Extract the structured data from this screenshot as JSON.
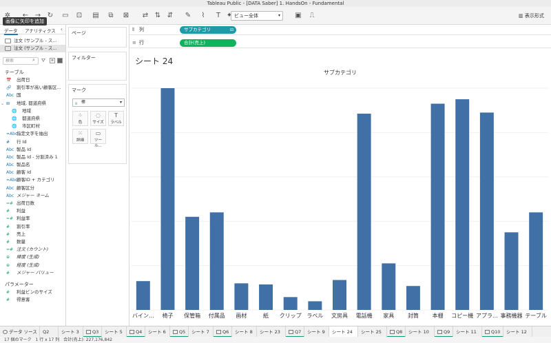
{
  "window": {
    "title": "Tableau Public - [DATA Saber] 1. HandsOn - Fundamental"
  },
  "toolbar": {
    "view_select": "ビュー全体",
    "show_me": "表示形式",
    "tooltip": "画像に矢印を追加"
  },
  "data_pane": {
    "tab_data": "データ",
    "tab_analytics": "アナリティクス",
    "datasources": [
      "注文 (サンプル - ス...",
      "注文 (サンプル - ス..."
    ],
    "search_placeholder": "検索",
    "section_tables": "テーブル",
    "fields": [
      {
        "icon": "📅",
        "type": "dim",
        "label": "出荷日"
      },
      {
        "icon": "🔗",
        "type": "dim",
        "label": "割引率が高い顧客区..."
      },
      {
        "icon": "Abc",
        "type": "dim",
        "label": "国"
      },
      {
        "icon": "⊞",
        "type": "dim",
        "label": "地域, 都道府県",
        "arrow": "⌄"
      },
      {
        "icon": "🌐",
        "type": "geo",
        "label": "地域",
        "indent": true
      },
      {
        "icon": "🌐",
        "type": "geo",
        "label": "都道府県",
        "indent": true
      },
      {
        "icon": "🌐",
        "type": "geo",
        "label": "市区町村",
        "indent": true
      },
      {
        "icon": "=Abc",
        "type": "dim",
        "label": "指定文字を抽出"
      },
      {
        "icon": "#",
        "type": "dim",
        "label": "行 Id"
      },
      {
        "icon": "Abc",
        "type": "dim",
        "label": "製品 Id"
      },
      {
        "icon": "Abc",
        "type": "dim",
        "label": "製品 Id - 分割済み 1"
      },
      {
        "icon": "Abc",
        "type": "dim",
        "label": "製品名"
      },
      {
        "icon": "Abc",
        "type": "dim",
        "label": "顧客 Id"
      },
      {
        "icon": "=Abc",
        "type": "dim",
        "label": "顧客ID + カテゴリ"
      },
      {
        "icon": "Abc",
        "type": "dim",
        "label": "顧客区分"
      },
      {
        "icon": "Abc",
        "type": "dim",
        "label": "メジャー ネーム",
        "italic": true
      },
      {
        "icon": "=#",
        "type": "meas",
        "label": "出荷日数"
      },
      {
        "icon": "#",
        "type": "meas",
        "label": "利益"
      },
      {
        "icon": "=#",
        "type": "meas",
        "label": "利益率"
      },
      {
        "icon": "#",
        "type": "meas",
        "label": "割引率"
      },
      {
        "icon": "#",
        "type": "meas",
        "label": "売上"
      },
      {
        "icon": "#",
        "type": "meas",
        "label": "数量"
      },
      {
        "icon": "=#",
        "type": "meas",
        "label": "注文 (カウント)",
        "italic": true
      },
      {
        "icon": "⊕",
        "type": "meas",
        "label": "緯度 (生成)",
        "italic": true
      },
      {
        "icon": "⊕",
        "type": "meas",
        "label": "経度 (生成)",
        "italic": true
      },
      {
        "icon": "#",
        "type": "meas",
        "label": "メジャー バリュー",
        "italic": true
      }
    ],
    "section_params": "パラメーター",
    "params": [
      {
        "icon": "#",
        "label": "利益ビンのサイズ"
      },
      {
        "icon": "#",
        "label": "得意客"
      }
    ]
  },
  "cards": {
    "pages": "ページ",
    "filters": "フィルター",
    "marks": "マーク",
    "mark_type": "棒",
    "mark_buttons": [
      {
        "glyph": "⁘",
        "label": "色"
      },
      {
        "glyph": "◌",
        "label": "サイズ"
      },
      {
        "glyph": "T",
        "label": "ラベル"
      },
      {
        "glyph": "⁙",
        "label": "詳細"
      },
      {
        "glyph": "▭",
        "label": "ツール..."
      }
    ]
  },
  "shelves": {
    "columns_label": "列",
    "columns_pill": "サブカテゴリ",
    "rows_label": "行",
    "rows_pill": "合計(売上)"
  },
  "sheet": {
    "title": "シート 24"
  },
  "chart_data": {
    "type": "bar",
    "title": "サブカテゴリ",
    "categories": [
      "バインダー",
      "椅子",
      "保管箱",
      "付属品",
      "画材",
      "紙",
      "クリップ",
      "ラベル",
      "文房具",
      "電話機",
      "家具",
      "封筒",
      "本棚",
      "コピー機",
      "アプライアンス",
      "事務機器",
      "テーブル"
    ],
    "tick_labels": [
      "バイン...",
      "椅子",
      "保管箱",
      "付属品",
      "画材",
      "紙",
      "クリップ",
      "ラベル",
      "文房具",
      "電話機",
      "家具",
      "封筒",
      "本棚",
      "コピー機",
      "アプラ...",
      "事務機器",
      "テーブル"
    ],
    "values": [
      0.13,
      1.0,
      0.42,
      0.44,
      0.12,
      0.115,
      0.058,
      0.039,
      0.135,
      0.885,
      0.21,
      0.108,
      0.93,
      0.95,
      0.89,
      0.35,
      0.44
    ],
    "color": "#4170a7",
    "grid": true
  },
  "tabs": {
    "items": [
      {
        "label": "データ ソース",
        "kind": "source"
      },
      {
        "label": "Q2",
        "kind": "green"
      },
      {
        "label": "シート 3",
        "kind": "plain"
      },
      {
        "label": "Q3",
        "kind": "dash"
      },
      {
        "label": "シート 5",
        "kind": "plain"
      },
      {
        "label": "Q4",
        "kind": "dash"
      },
      {
        "label": "シート 6",
        "kind": "plain"
      },
      {
        "label": "Q5",
        "kind": "dash"
      },
      {
        "label": "シート 7",
        "kind": "plain"
      },
      {
        "label": "Q6",
        "kind": "dash"
      },
      {
        "label": "シート 8",
        "kind": "plain"
      },
      {
        "label": "シート 23",
        "kind": "plain"
      },
      {
        "label": "Q7",
        "kind": "dash"
      },
      {
        "label": "シート 9",
        "kind": "plain"
      },
      {
        "label": "シート 24",
        "kind": "active"
      },
      {
        "label": "シート 25",
        "kind": "plain"
      },
      {
        "label": "Q8",
        "kind": "dash"
      },
      {
        "label": "シート 10",
        "kind": "plain"
      },
      {
        "label": "Q9",
        "kind": "dash"
      },
      {
        "label": "シート 11",
        "kind": "plain"
      },
      {
        "label": "Q10",
        "kind": "dash"
      },
      {
        "label": "シート 12",
        "kind": "plain"
      }
    ]
  },
  "status": {
    "text": "17 個のマーク　1 行 x 17 列　合計(売上): 227,176,842"
  }
}
